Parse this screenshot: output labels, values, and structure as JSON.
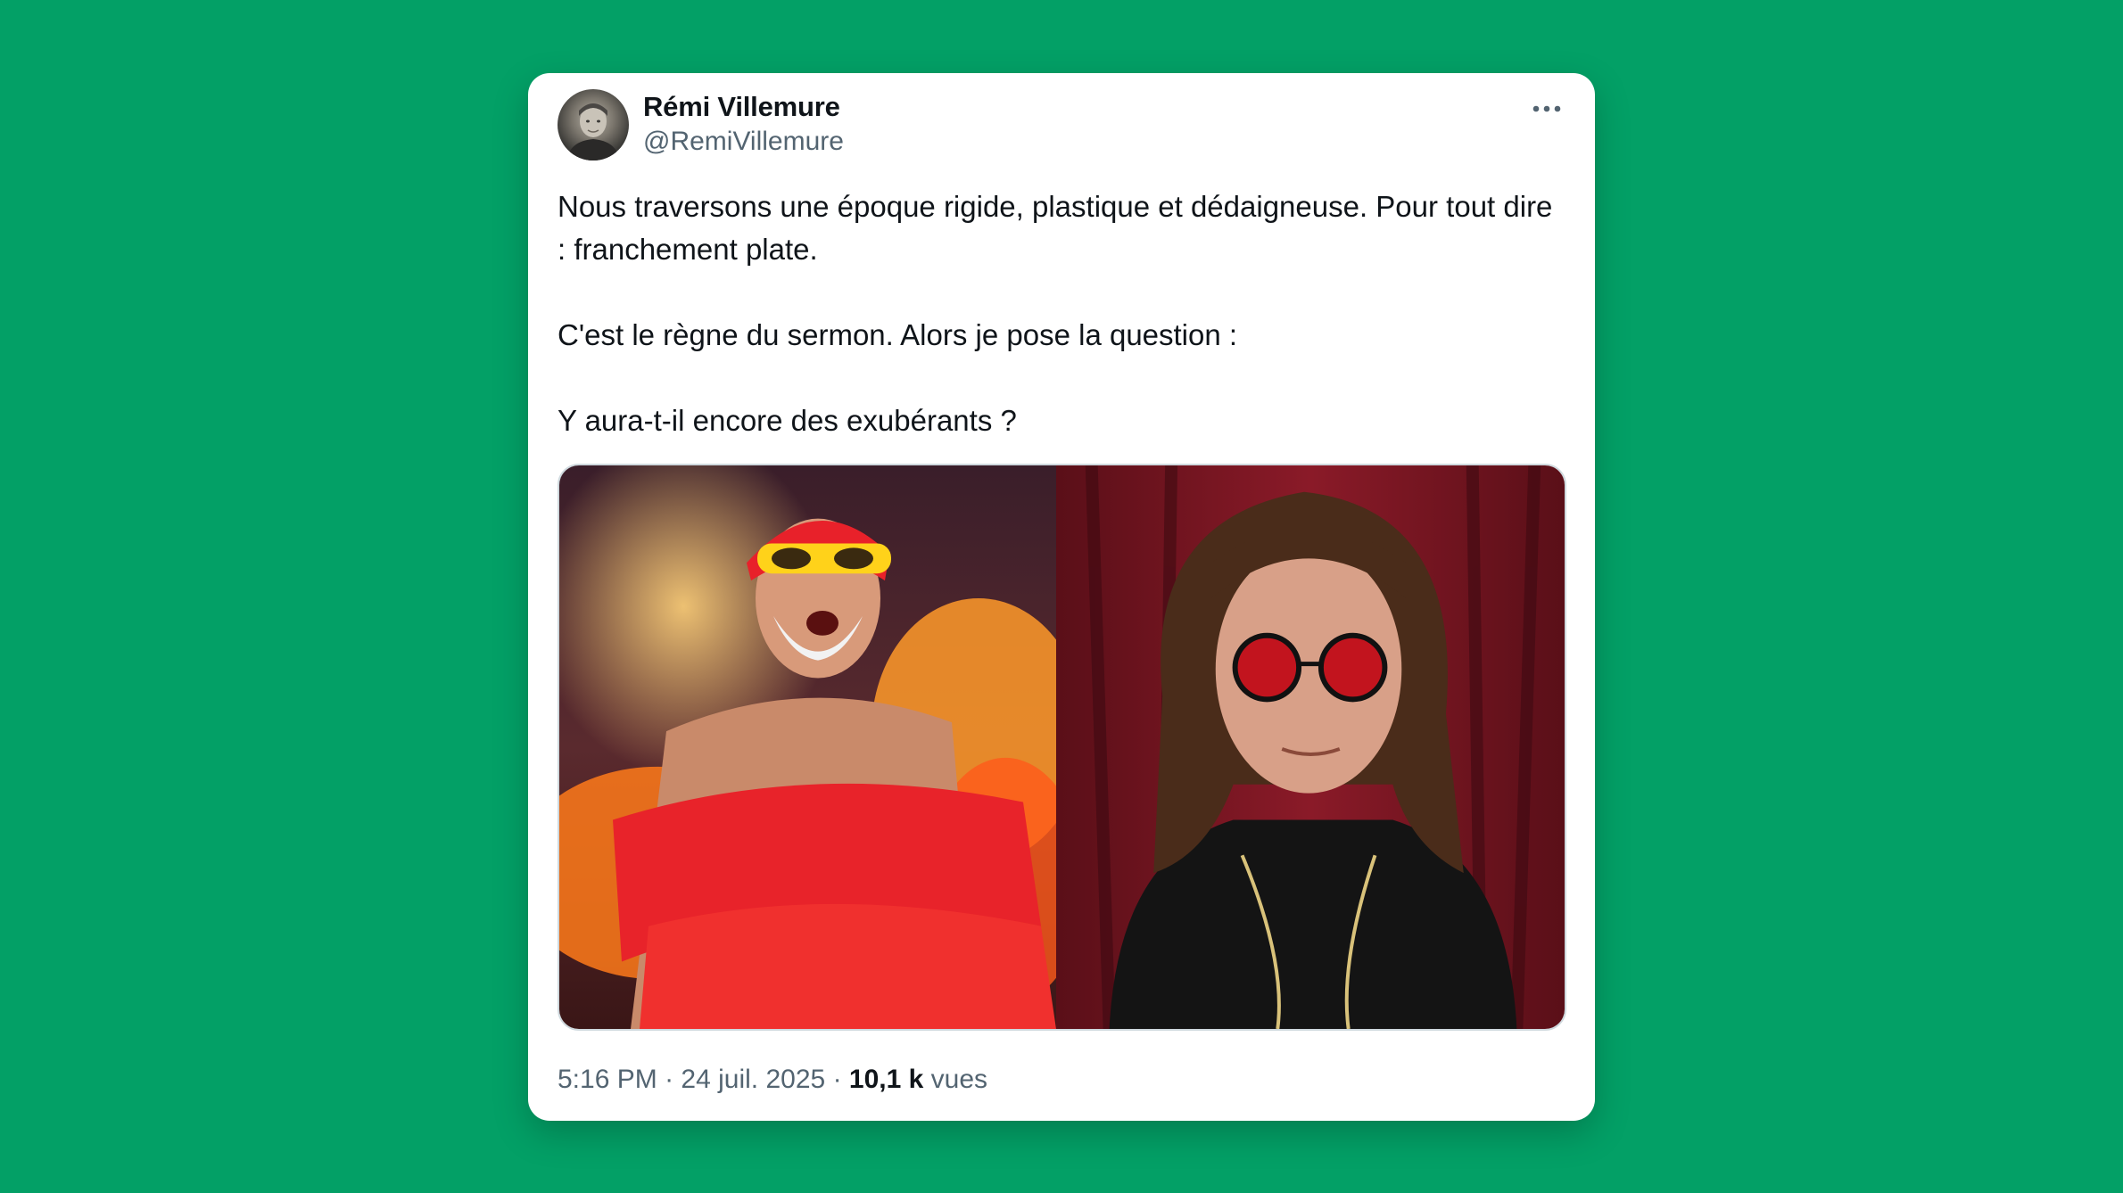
{
  "tweet": {
    "author_name": "Rémi Villemure",
    "author_handle": "@RemiVillemure",
    "more_icon": "more-horizontal-icon",
    "text_paragraphs": [
      "Nous traversons une époque rigide, plastique et dédaigneuse. Pour tout dire : franchement plate.",
      "C'est le règne du sermon. Alors je pose la question :",
      "Y aura-t-il encore des exubérants ?"
    ],
    "time": "5:16 PM",
    "separator": "·",
    "date": "24 juil. 2025",
    "views_count": "10,1 k",
    "views_label": "vues"
  },
  "colors": {
    "background": "#03a066",
    "card": "#ffffff",
    "primary_text": "#0f1419",
    "secondary_text": "#536471"
  }
}
